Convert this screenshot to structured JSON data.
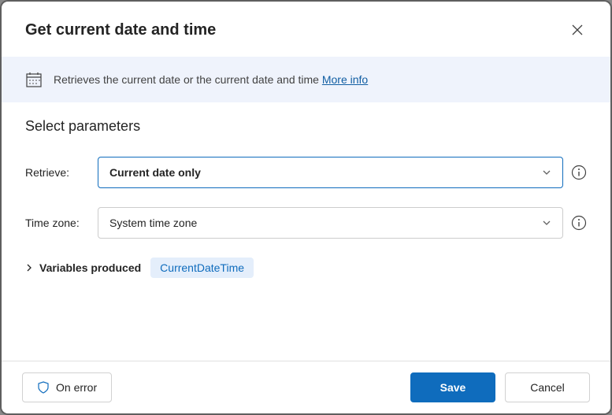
{
  "header": {
    "title": "Get current date and time"
  },
  "banner": {
    "text": "Retrieves the current date or the current date and time ",
    "more_link": "More info"
  },
  "params": {
    "heading": "Select parameters",
    "retrieve_label": "Retrieve:",
    "retrieve_value": "Current date only",
    "timezone_label": "Time zone:",
    "timezone_value": "System time zone"
  },
  "vars": {
    "label": "Variables produced",
    "chip": "CurrentDateTime"
  },
  "footer": {
    "on_error": "On error",
    "save": "Save",
    "cancel": "Cancel"
  }
}
